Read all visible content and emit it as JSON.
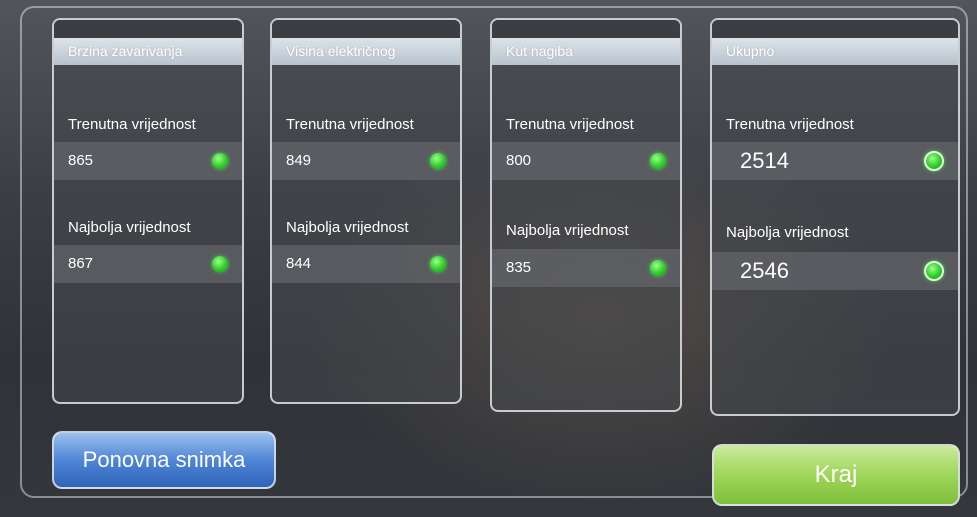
{
  "panels": [
    {
      "title": "Brzina zavarivanja",
      "current_label": "Trenutna vrijednost",
      "current_value": "865",
      "best_label": "Najbolja vrijednost",
      "best_value": "867"
    },
    {
      "title": "Visina električnog",
      "current_label": "Trenutna vrijednost",
      "current_value": "849",
      "best_label": "Najbolja vrijednost",
      "best_value": "844"
    },
    {
      "title": "Kut nagiba",
      "current_label": "Trenutna vrijednost",
      "current_value": "800",
      "best_label": "Najbolja vrijednost",
      "best_value": "835"
    },
    {
      "title": "Ukupno",
      "current_label": "Trenutna vrijednost",
      "current_value": "2514",
      "best_label": "Najbolja vrijednost",
      "best_value": "2546"
    }
  ],
  "buttons": {
    "retry": "Ponovna snimka",
    "end": "Kraj"
  },
  "colors": {
    "status_ok": "#2ecc2a",
    "retry_button": "#4f86d6",
    "end_button": "#9fd65a"
  },
  "icons": {
    "status": "green-status-dot-icon"
  }
}
